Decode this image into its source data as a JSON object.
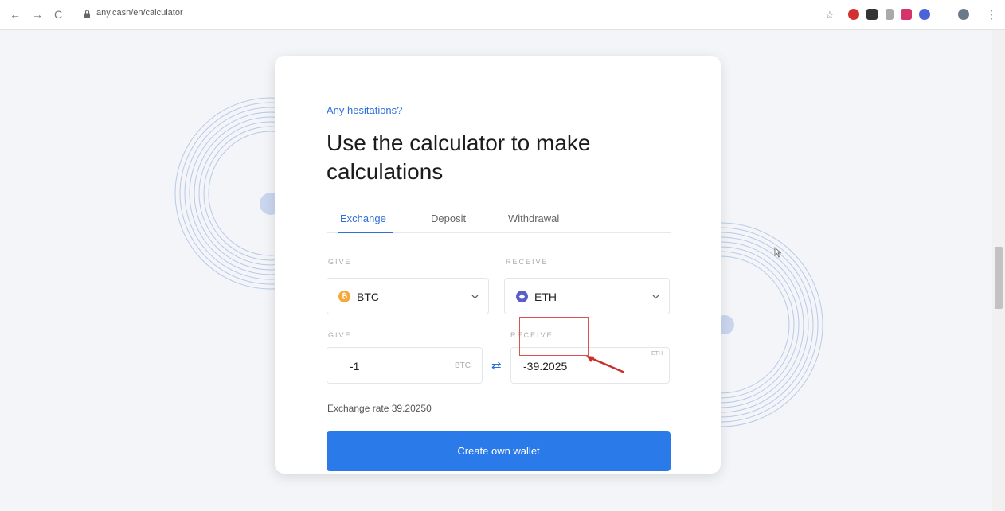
{
  "browser": {
    "url": "any.cash/en/calculator",
    "nav_back": "←",
    "nav_forward": "→",
    "nav_reload": "C",
    "star": "☆",
    "menu": "⋮"
  },
  "card": {
    "eyebrow": "Any hesitations?",
    "title": "Use the calculator to make calculations",
    "tabs": [
      {
        "label": "Exchange",
        "active": true
      },
      {
        "label": "Deposit",
        "active": false
      },
      {
        "label": "Withdrawal",
        "active": false
      }
    ],
    "give_label": "GIVE",
    "receive_label": "RECEIVE",
    "give_currency": {
      "symbol": "BTC",
      "color": "#f7a738",
      "glyph": "₿"
    },
    "receive_currency": {
      "symbol": "ETH",
      "color": "#5b5ec9",
      "glyph": "◆"
    },
    "give_amount": "-1",
    "give_unit": "BTC",
    "receive_amount": "-39.2025",
    "receive_unit": "ETH",
    "exchange_rate": "Exchange rate 39.20250",
    "cta": "Create own wallet"
  },
  "colors": {
    "accent": "#2f6fd6",
    "button": "#2a7ae9",
    "annotation": "#d9534f"
  }
}
